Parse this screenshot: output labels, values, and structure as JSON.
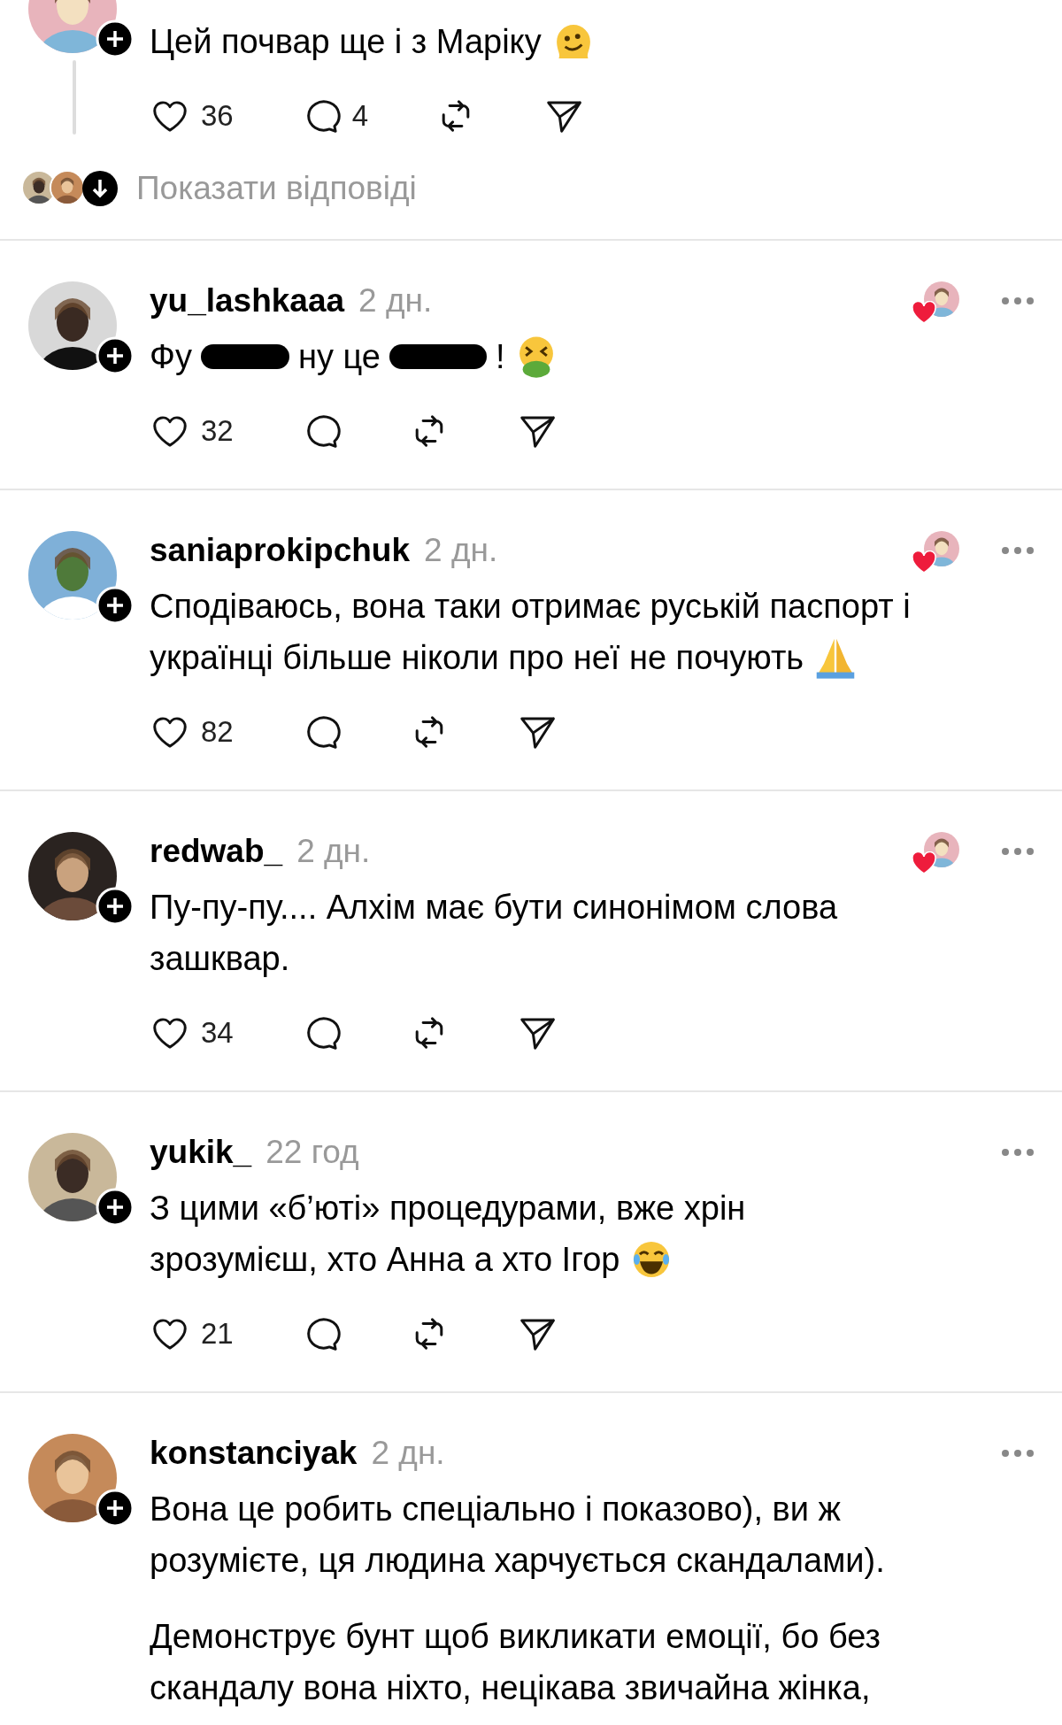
{
  "thread_tail": {
    "body": [
      {
        "kind": "text",
        "text": "Цей почвар ще і з Маріку"
      },
      {
        "kind": "melting-emoji"
      }
    ],
    "likes": "36",
    "replies": "4"
  },
  "show_replies": {
    "label": "Показати відповіді"
  },
  "comments": [
    {
      "username": "yu_lashkaaa",
      "time": "2 дн.",
      "author_liked": true,
      "paragraphs": [
        [
          [
            {
              "kind": "text",
              "text": "Фу"
            },
            {
              "kind": "redacted"
            },
            {
              "kind": "text",
              "text": "ну це"
            },
            {
              "kind": "redacted"
            },
            {
              "kind": "text",
              "text": "!"
            },
            {
              "kind": "vomit-emoji"
            }
          ]
        ]
      ],
      "likes": "32"
    },
    {
      "username": "saniaprokipchuk",
      "time": "2 дн.",
      "author_liked": true,
      "paragraphs": [
        [
          [
            {
              "kind": "text",
              "text": "Сподіваюсь, вона таки отримає руській паспорт і"
            }
          ],
          [
            {
              "kind": "text",
              "text": "українці більше ніколи про неї не почують"
            },
            {
              "kind": "pray-emoji"
            }
          ]
        ]
      ],
      "likes": "82"
    },
    {
      "username": "redwab_",
      "time": "2 дн.",
      "author_liked": true,
      "paragraphs": [
        [
          [
            {
              "kind": "text",
              "text": "Пу-пу-пу.... Алхім має бути синонімом слова"
            }
          ],
          [
            {
              "kind": "text",
              "text": "зашквар."
            }
          ]
        ]
      ],
      "likes": "34"
    },
    {
      "username": "yukik_",
      "time": "22 год",
      "author_liked": false,
      "paragraphs": [
        [
          [
            {
              "kind": "text",
              "text": "З цими «б’юті» процедурами, вже хрін"
            }
          ],
          [
            {
              "kind": "text",
              "text": "зрозумієш, хто Анна а хто Ігор"
            },
            {
              "kind": "laugh-emoji"
            }
          ]
        ]
      ],
      "likes": "21"
    },
    {
      "username": "konstanciyak",
      "time": "2 дн.",
      "author_liked": false,
      "paragraphs": [
        [
          [
            {
              "kind": "text",
              "text": "Вона це робить спеціально і показово), ви ж"
            }
          ],
          [
            {
              "kind": "text",
              "text": "розумієте, ця людина харчується скандалами)."
            }
          ]
        ],
        [
          [
            {
              "kind": "text",
              "text": "Демонструє бунт щоб викликати емоції, бо без"
            }
          ],
          [
            {
              "kind": "text",
              "text": "скандалу вона ніхто, нецікава звичайна жінка,"
            }
          ]
        ]
      ]
    }
  ]
}
